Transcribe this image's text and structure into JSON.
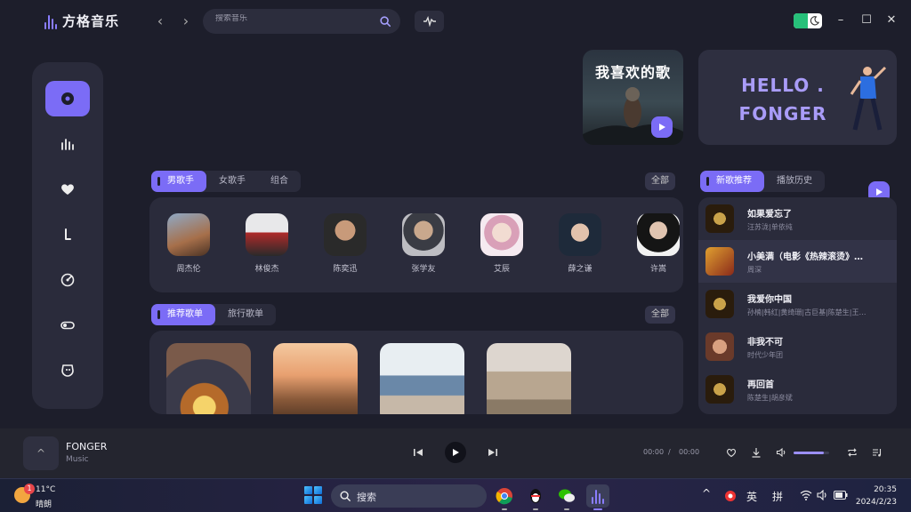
{
  "app": {
    "name": "方格音乐"
  },
  "search": {
    "placeholder": "搜索音乐"
  },
  "banners": {
    "favorites_title": "我喜欢的歌",
    "hello_line1": "HELLO .",
    "hello_line2": "FONGER"
  },
  "artists_section": {
    "tabs": [
      "男歌手",
      "女歌手",
      "组合"
    ],
    "all_label": "全部",
    "artists": [
      "周杰伦",
      "林俊杰",
      "陈奕迅",
      "张学友",
      "艾辰",
      "薛之谦",
      "许嵩"
    ]
  },
  "playlists_section": {
    "tabs": [
      "推荐歌单",
      "旅行歌单"
    ],
    "all_label": "全部"
  },
  "songs_section": {
    "tabs": [
      "新歌推荐",
      "播放历史"
    ],
    "songs": [
      {
        "title": "如果爱忘了",
        "artist": "汪苏泷|单依纯"
      },
      {
        "title": "小美满（电影《热辣滚烫》…",
        "artist": "周深"
      },
      {
        "title": "我爱你中国",
        "artist": "孙楠|韩红|黄绮珊|古巨基|陈楚生|王…"
      },
      {
        "title": "非我不可",
        "artist": "时代少年团"
      },
      {
        "title": "再回首",
        "artist": "陈楚生|胡彦斌"
      }
    ]
  },
  "player": {
    "title": "FONGER",
    "subtitle": "Music",
    "current_time": "00:00",
    "separator": "/",
    "total_time": "00:00",
    "volume": 0.85,
    "expand_label": "^"
  },
  "taskbar": {
    "weather_badge": "1",
    "temperature": "11°C",
    "condition": "晴朗",
    "search_label": "搜索",
    "ime_lang": "英",
    "ime_mode": "拼",
    "time": "20:35",
    "date": "2024/2/23"
  },
  "colors": {
    "accent": "#7b6cf6",
    "background": "#1d1e2b",
    "panel": "#2a2b3b"
  }
}
